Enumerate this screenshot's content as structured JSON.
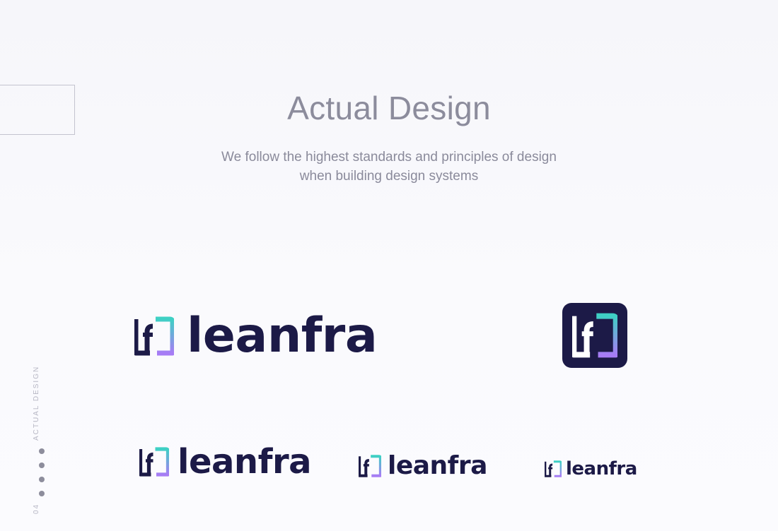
{
  "hero": {
    "title": "Actual Design",
    "subtitle_line1": "We follow the highest standards and principles of design",
    "subtitle_line2": "when building design systems"
  },
  "brand": {
    "wordmark": "leanfra",
    "colors": {
      "navy": "#1c1a47",
      "gradient_start": "#3ed0c4",
      "gradient_end": "#a77cf5"
    }
  },
  "sidebar": {
    "section_label": "ACTUAL DESIGN",
    "page_number": "04",
    "dots_count": 4
  }
}
